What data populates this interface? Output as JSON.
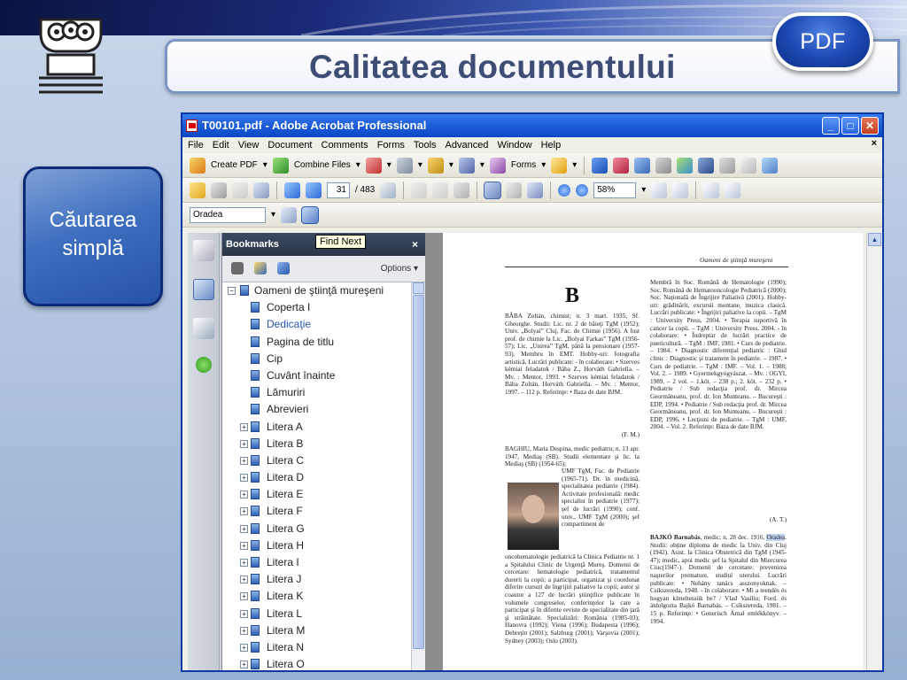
{
  "slide": {
    "title": "Calitatea documentului",
    "badge": "PDF",
    "side_tile": [
      "Căutarea",
      "simplă"
    ],
    "colors": {
      "title": "#3e4d75",
      "tile": "#2553a8",
      "badge": "#1a47b0"
    }
  },
  "window": {
    "title": "T00101.pdf - Adobe Acrobat Professional",
    "controls": [
      "minimize-icon",
      "maximize-icon",
      "close-icon"
    ],
    "menu": [
      "File",
      "Edit",
      "View",
      "Document",
      "Comments",
      "Forms",
      "Tools",
      "Advanced",
      "Window",
      "Help"
    ],
    "menu_close": "×",
    "toolbar1": {
      "create_pdf": "Create PDF",
      "combine_files": "Combine Files",
      "forms": "Forms"
    },
    "toolbar2": {
      "page_current": "31",
      "page_total": "/ 483",
      "zoom": "58%"
    },
    "find": {
      "query": "Oradea",
      "tooltip": "Find Next"
    }
  },
  "bookmarks": {
    "header": "Bookmarks",
    "close": "×",
    "options": "Options",
    "root": "Oameni de ştiinţă mureşeni",
    "items": [
      {
        "label": "Coperta I",
        "expandable": false
      },
      {
        "label": "Dedicaţie",
        "expandable": false,
        "selected": true
      },
      {
        "label": "Pagina de titlu",
        "expandable": false
      },
      {
        "label": "Cip",
        "expandable": false
      },
      {
        "label": "Cuvânt înainte",
        "expandable": false
      },
      {
        "label": "Lămuriri",
        "expandable": false
      },
      {
        "label": "Abrevieri",
        "expandable": false
      },
      {
        "label": "Litera A",
        "expandable": true
      },
      {
        "label": "Litera B",
        "expandable": true
      },
      {
        "label": "Litera C",
        "expandable": true
      },
      {
        "label": "Litera D",
        "expandable": true
      },
      {
        "label": "Litera E",
        "expandable": true
      },
      {
        "label": "Litera F",
        "expandable": true
      },
      {
        "label": "Litera G",
        "expandable": true
      },
      {
        "label": "Litera H",
        "expandable": true
      },
      {
        "label": "Litera I",
        "expandable": true
      },
      {
        "label": "Litera J",
        "expandable": true
      },
      {
        "label": "Litera K",
        "expandable": true
      },
      {
        "label": "Litera L",
        "expandable": true
      },
      {
        "label": "Litera M",
        "expandable": true
      },
      {
        "label": "Litera N",
        "expandable": true
      },
      {
        "label": "Litera O",
        "expandable": true
      }
    ]
  },
  "page": {
    "running_head": "Oameni de ştiinţă mureşeni",
    "letter": "B",
    "col1_entry1": "BÂBA Zoltán, chimist; n. 3 mart. 1935, Sf. Gheorghe. Studii: Lic. nr. 2 de băieţi TgM (1952); Univ. „Bolyai” Cluj, Fac. de Chimie (1956). A fost prof. de chimie la Lic. „Bolyai Farkas” TgM (1956-57); Lic. „Unirea” TgM, până la pensionare (1957-93). Membru în EMT. Hobby-uri: fotografia artistică. Lucrări publicate: - în colaborare: • Szerves kémiai feladatok / Bába Z., Horváth Gabriella. – Mv. : Mentor, 1993. • Szerves kémiai feladatok / Bába Zoltán, Horváth Gabriella. – Mv. : Mentor, 1997. – 112 p. Referinţe: • Baza de date BJM.",
    "col1_sig1": "(F. M.)",
    "col1_entry2_head": "BAGHIU, Maria Despina, medic pediatru; n. 13 apr. 1947, Mediaş (SB). Studii elementare şi lic. la Mediaş (SB) (1954-65);",
    "col1_entry2_side": "UMF TgM, Fac. de Pediatrie (1965-71). Dr. în medicină, specialitatea pediatrie (1984). Activitate profesională: medic specialist în pediatrie (1977); şef de lucrări (1990); conf. univ., UMF TgM (2000); şef compartiment de",
    "col1_entry2_body": "oncohematologie pediatrică la Clinica Pediatrie nr. 1 a Spitalului Clinic de Urgenţă Mureş. Domenii de cercetare: hematologie pediatrică, tratamentul durerii la copii; a participat, organizat şi coordonat diferite cursuri de îngrijiri paliative la copii; autor şi coautor a 127 de lucrări ştiinţifice publicate în volumele congreselor, conferinţelor la care a participat şi în diferite reviste de specialitate din ţară şi străinătate. Specializări: România (1985-03); Hanovra (1992); Viena (1996); Budapesta (1996); Debreţin (2001); Salzburg (2001); Varşovia (2001); Sydney (2003); Oslo (2003).",
    "col2_text": "Membră în Soc. Română de Hematologie (1990); Soc. Română de Hematooncologie Pediatrică (2000); Soc. Naţională de Îngrijire Paliativă (2001). Hobby-uri: grădinărit, excursii montane, muzica clasică. Lucrări publicate: • Îngrijiri paliative la copii. – TgM : University Press, 2004. • Terapia suportivă în cancer la copii. – TgM : University Press, 2004. - în colaborare: • Îndreptar de lucrări practice de puericultură. – TgM : IMF, 1981. • Curs de pediatrie. – 1984. • Diagnostic diferenţial pediatric : Ghid clinic : Diagnostic şi tratament în pediatrie. – 1987. • Curs de pediatrie. – TgM : IMF. – Vol. 1. – 1988; Vol. 2. – 1989. • Gyermekgyógyászat. – Mv. : OGYI, 1989. – 2 vol. – 1.köt. – 238 p.; 2. köt. – 232 p. • Pediatrie / Sub redacţia prof. dr. Mircea Geormăneanu, prof. dr. Ion Munteanu. – Bucureşti : EDP, 1994. • Pediatrie / Sub redacţia prof. dr. Mircea Geormăneanu, prof. dr. Ion Munteanu. – Bucureşti : EDP, 1996. • Lecţiuni de pediatrie. – TgM : UMF, 2004. – Vol. 2. Referinţe: Baza de date BJM.",
    "col2_sig": "(A. T.)",
    "col2_entry3_name": "BAJKÓ Barnabás",
    "col2_entry3_pre": ", medic; n. 28 dec. 1916,",
    "col2_entry3_hl": "Oradea",
    "col2_entry3_post": ". Studii: obţine diploma de medic la Univ. din Cluj (1942). Asist. la Clinica Obstetrică din TgM (1945-47); medic, apoi medic şef la Spitalul din Miercurea Ciuc(1947-). Domenii de cercetare: prevenirea naşterilor premature, studiul uterului. Lucrări publicate: • Nehány tanács asszonyoknak. – Csíkszereda, 1948. - în colaborare: • Mi a teendés és hogyan kímeltessük be? / Vlad Vasiliu; Ford. és átdolgozta Bajkó Barnabás. – Csíkszereda, 1981. – 15 p. Referinţe: • Generisch Árnal emlékkönyv. – 1994."
  }
}
